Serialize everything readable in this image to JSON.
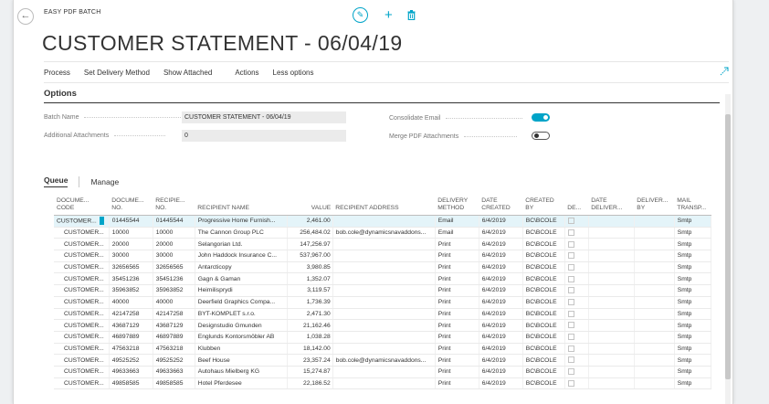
{
  "breadcrumb": "EASY PDF BATCH",
  "page_title": "CUSTOMER STATEMENT - 06/04/19",
  "actions": [
    "Process",
    "Set Delivery Method",
    "Show Attached",
    "Actions",
    "Less options"
  ],
  "options": {
    "heading": "Options",
    "batch_name_label": "Batch Name",
    "batch_name_value": "CUSTOMER STATEMENT - 06/04/19",
    "additional_attachments_label": "Additional Attachments",
    "additional_attachments_value": "0",
    "consolidate_email_label": "Consolidate Email",
    "consolidate_email_on": true,
    "merge_pdf_label": "Merge PDF Attachments",
    "merge_pdf_on": false
  },
  "subtabs": [
    "Queue",
    "Manage"
  ],
  "table": {
    "headers": [
      [
        "DOCUME...",
        "CODE"
      ],
      [
        "DOCUME...",
        "NO."
      ],
      [
        "RECIPIE...",
        "NO."
      ],
      [
        "",
        "RECIPIENT NAME"
      ],
      [
        "",
        "VALUE"
      ],
      [
        "",
        "RECIPIENT ADDRESS"
      ],
      [
        "DELIVERY",
        "METHOD"
      ],
      [
        "DATE",
        "CREATED"
      ],
      [
        "CREATED",
        "BY"
      ],
      [
        "",
        "DE..."
      ],
      [
        "DATE",
        "DELIVER..."
      ],
      [
        "DELIVER...",
        "BY"
      ],
      [
        "MAIL",
        "TRANSP..."
      ]
    ],
    "rows": [
      [
        "CUSTOMER...",
        "01445544",
        "01445544",
        "Progressive Home Furnish...",
        "2,461.00",
        "",
        "Email",
        "6/4/2019",
        "BC\\BCOLE",
        "",
        "",
        "",
        "Smtp"
      ],
      [
        "CUSTOMER...",
        "10000",
        "10000",
        "The Cannon Group PLC",
        "256,484.02",
        "bob.cole@dynamicsnavaddons...",
        "Email",
        "6/4/2019",
        "BC\\BCOLE",
        "",
        "",
        "",
        "Smtp"
      ],
      [
        "CUSTOMER...",
        "20000",
        "20000",
        "Selangorian Ltd.",
        "147,256.97",
        "",
        "Print",
        "6/4/2019",
        "BC\\BCOLE",
        "",
        "",
        "",
        "Smtp"
      ],
      [
        "CUSTOMER...",
        "30000",
        "30000",
        "John Haddock Insurance C...",
        "537,967.00",
        "",
        "Print",
        "6/4/2019",
        "BC\\BCOLE",
        "",
        "",
        "",
        "Smtp"
      ],
      [
        "CUSTOMER...",
        "32656565",
        "32656565",
        "Antarcticopy",
        "3,980.85",
        "",
        "Print",
        "6/4/2019",
        "BC\\BCOLE",
        "",
        "",
        "",
        "Smtp"
      ],
      [
        "CUSTOMER...",
        "35451236",
        "35451236",
        "Gagn & Gaman",
        "1,352.07",
        "",
        "Print",
        "6/4/2019",
        "BC\\BCOLE",
        "",
        "",
        "",
        "Smtp"
      ],
      [
        "CUSTOMER...",
        "35963852",
        "35963852",
        "Heimilisprydi",
        "3,119.57",
        "",
        "Print",
        "6/4/2019",
        "BC\\BCOLE",
        "",
        "",
        "",
        "Smtp"
      ],
      [
        "CUSTOMER...",
        "40000",
        "40000",
        "Deerfield Graphics Compa...",
        "1,736.39",
        "",
        "Print",
        "6/4/2019",
        "BC\\BCOLE",
        "",
        "",
        "",
        "Smtp"
      ],
      [
        "CUSTOMER...",
        "42147258",
        "42147258",
        "BYT-KOMPLET s.r.o.",
        "2,471.30",
        "",
        "Print",
        "6/4/2019",
        "BC\\BCOLE",
        "",
        "",
        "",
        "Smtp"
      ],
      [
        "CUSTOMER...",
        "43687129",
        "43687129",
        "Designstudio Gmunden",
        "21,162.46",
        "",
        "Print",
        "6/4/2019",
        "BC\\BCOLE",
        "",
        "",
        "",
        "Smtp"
      ],
      [
        "CUSTOMER...",
        "46897889",
        "46897889",
        "Englunds Kontorsmöbler AB",
        "1,038.28",
        "",
        "Print",
        "6/4/2019",
        "BC\\BCOLE",
        "",
        "",
        "",
        "Smtp"
      ],
      [
        "CUSTOMER...",
        "47563218",
        "47563218",
        "Klubben",
        "18,142.00",
        "",
        "Print",
        "6/4/2019",
        "BC\\BCOLE",
        "",
        "",
        "",
        "Smtp"
      ],
      [
        "CUSTOMER...",
        "49525252",
        "49525252",
        "Beef House",
        "23,357.24",
        "bob.cole@dynamicsnavaddons...",
        "Print",
        "6/4/2019",
        "BC\\BCOLE",
        "",
        "",
        "",
        "Smtp"
      ],
      [
        "CUSTOMER...",
        "49633663",
        "49633663",
        "Autohaus Mielberg KG",
        "15,274.87",
        "",
        "Print",
        "6/4/2019",
        "BC\\BCOLE",
        "",
        "",
        "",
        "Smtp"
      ],
      [
        "CUSTOMER...",
        "49858585",
        "49858585",
        "Hotel Pferdesee",
        "22,186.52",
        "",
        "Print",
        "6/4/2019",
        "BC\\BCOLE",
        "",
        "",
        "",
        "Smtp"
      ]
    ]
  },
  "colors": {
    "accent": "#00a4c8",
    "selected_row": "#e4f4f9",
    "text": "#333333"
  },
  "icons": [
    "back-arrow-icon",
    "edit-pencil-icon",
    "plus-icon",
    "trash-icon",
    "collapse-arrows-icon"
  ]
}
